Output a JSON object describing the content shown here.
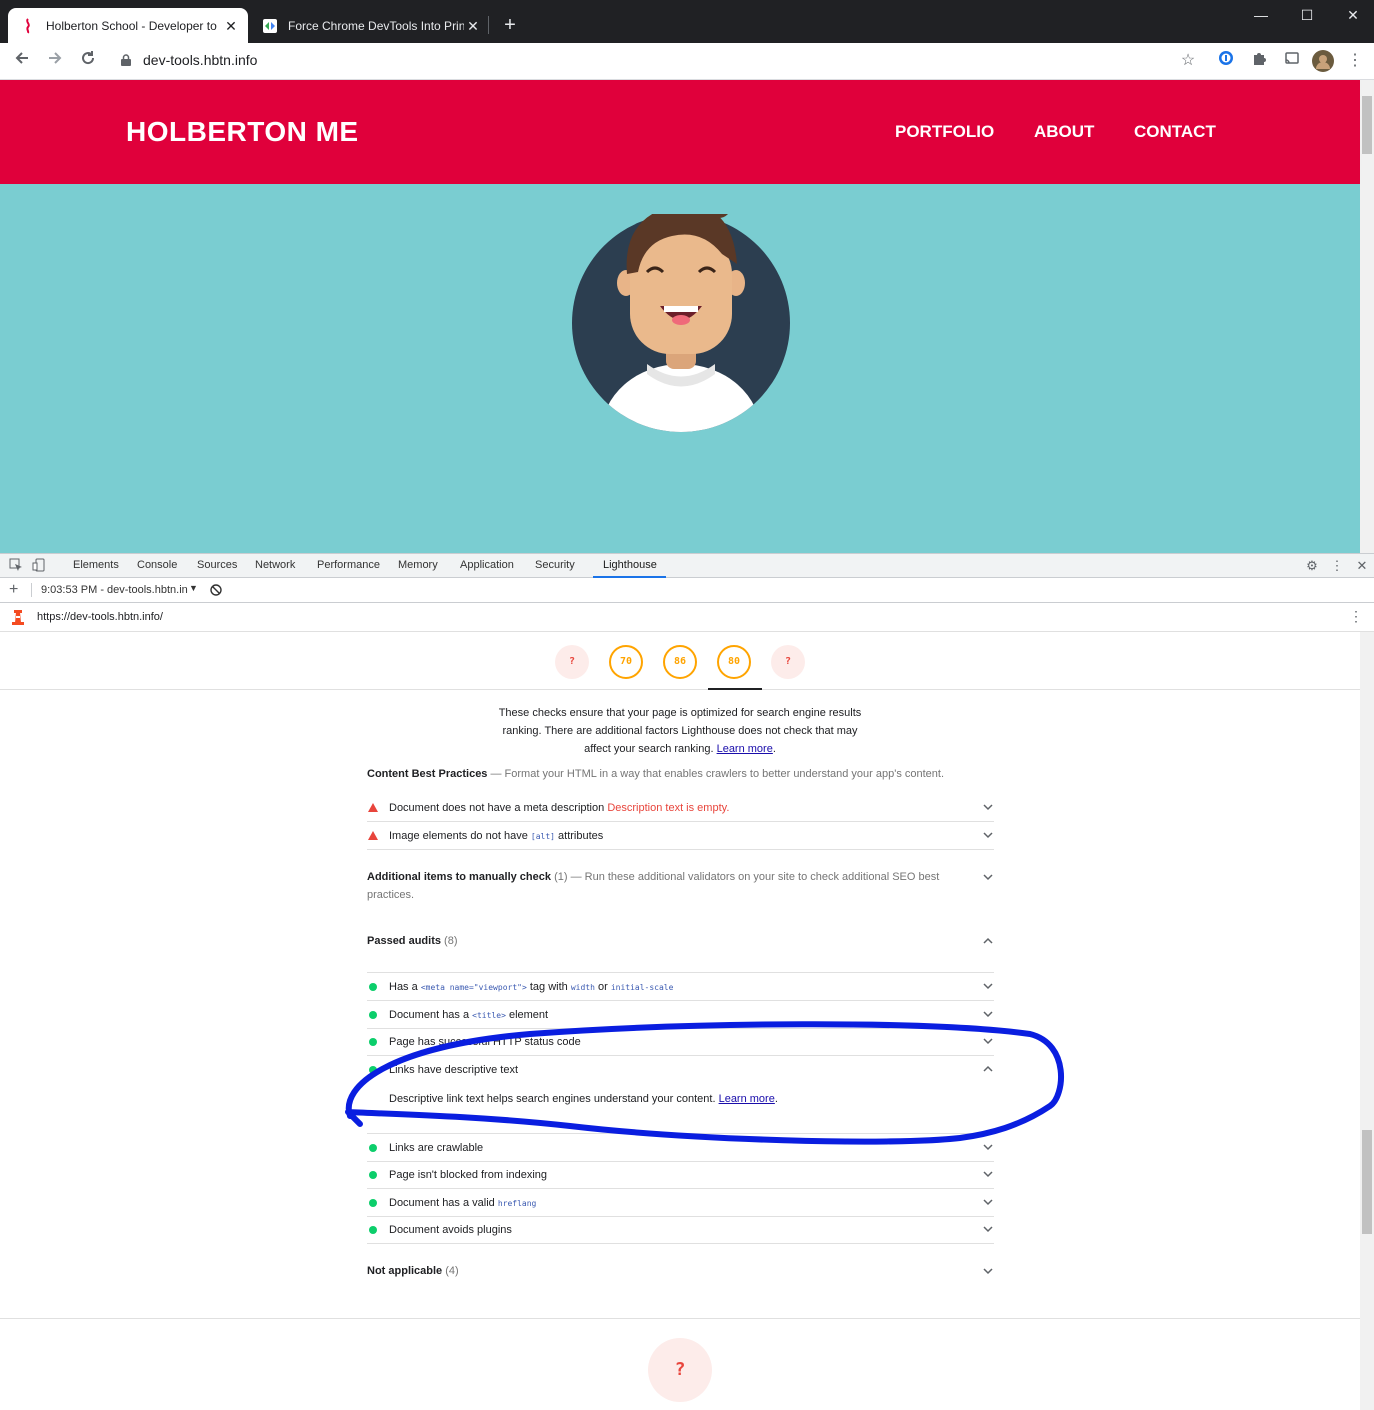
{
  "browser": {
    "tabs": [
      {
        "title": "Holberton School - Developer to",
        "active": true
      },
      {
        "title": "Force Chrome DevTools Into Prin",
        "active": false
      }
    ],
    "new_tab": "+",
    "window_controls": {
      "minimize": "—",
      "maximize": "☐",
      "close": "✕"
    },
    "url": "dev-tools.hbtn.info"
  },
  "site": {
    "brand": "HOLBERTON ME",
    "nav": [
      "PORTFOLIO",
      "ABOUT",
      "CONTACT"
    ],
    "colors": {
      "header": "#e0003b",
      "hero": "#7acdd1"
    }
  },
  "devtools": {
    "tabs": [
      "Elements",
      "Console",
      "Sources",
      "Network",
      "Performance",
      "Memory",
      "Application",
      "Security",
      "Lighthouse"
    ],
    "active_tab": "Lighthouse",
    "report_selector": "9:03:53 PM - dev-tools.hbtn.in",
    "report_url": "https://dev-tools.hbtn.info/"
  },
  "lighthouse": {
    "gauges": [
      "?",
      "70",
      "86",
      "80",
      "?"
    ],
    "seo_description": "These checks ensure that your page is optimized for search engine results ranking. There are additional factors Lighthouse does not check that may affect your search ranking.",
    "learn_more": "Learn more",
    "content_best_practices": {
      "title": "Content Best Practices",
      "desc": "— Format your HTML in a way that enables crawlers to better understand your app's content."
    },
    "failed_audits": [
      {
        "label": "Document does not have a meta description",
        "extra": "Description text is empty."
      },
      {
        "label_pre": "Image elements do not have",
        "code": "[alt]",
        "label_post": "attributes"
      }
    ],
    "manual": {
      "title": "Additional items to manually check",
      "count": "(1)",
      "desc": "— Run these additional validators on your site to check additional SEO best practices."
    },
    "passed": {
      "title": "Passed audits",
      "count": "(8)",
      "items": [
        {
          "pre": "Has a",
          "code1": "<meta name=\"viewport\">",
          "mid": "tag with",
          "code2": "width",
          "or": "or",
          "code3": "initial-scale"
        },
        {
          "pre": "Document has a",
          "code": "<title>",
          "post": "element"
        },
        {
          "label": "Page has successful HTTP status code"
        },
        {
          "label": "Links have descriptive text",
          "detail": "Descriptive link text helps search engines understand your content.",
          "detail_link": "Learn more"
        },
        {
          "label": "Links are crawlable"
        },
        {
          "label": "Page isn't blocked from indexing"
        },
        {
          "pre": "Document has a valid",
          "code": "hreflang"
        },
        {
          "label": "Document avoids plugins"
        }
      ]
    },
    "not_applicable": {
      "title": "Not applicable",
      "count": "(4)"
    },
    "bottom_gauge": "?"
  }
}
